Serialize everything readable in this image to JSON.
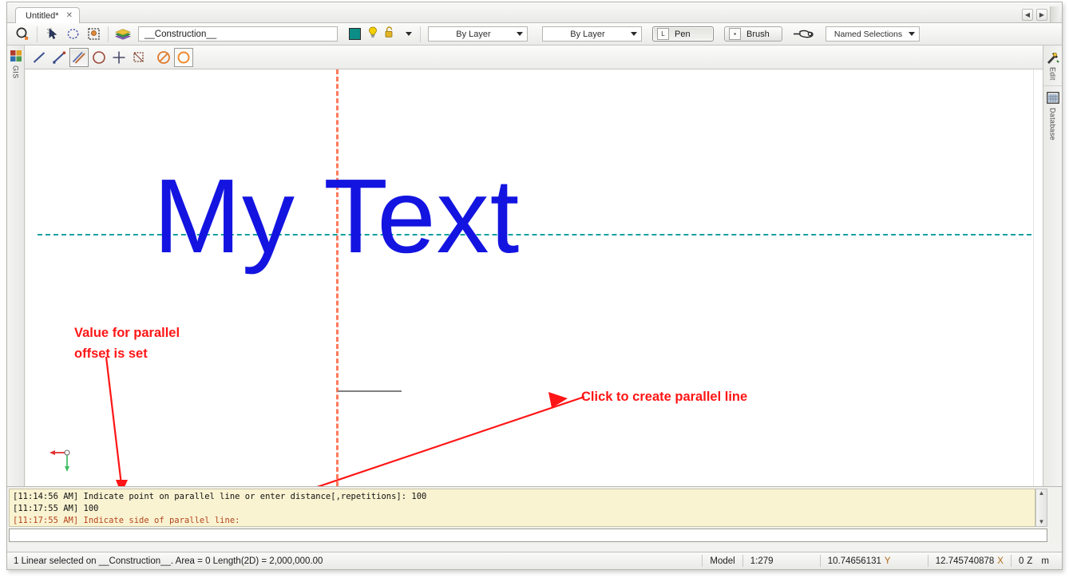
{
  "window": {
    "tab": {
      "title": "Untitled*",
      "close": "✕"
    },
    "tab_nav": {
      "prev": "◀",
      "next": "▶"
    }
  },
  "toolbar": {
    "icons": [
      {
        "name": "select-objects-icon",
        "glyph": "select"
      },
      {
        "name": "pointer-icon",
        "glyph": "pointer"
      },
      {
        "name": "lasso-select-icon",
        "glyph": "lasso"
      },
      {
        "name": "marquee-select-icon",
        "glyph": "marquee"
      },
      {
        "name": "layers-icon",
        "glyph": "layers"
      }
    ],
    "layer_name": "__Construction__",
    "color_swatch": "#0c8d86",
    "lightbulb_icon": "bulb-icon",
    "lock_icon": "lock-icon",
    "layer_dropdown_caret": "▾",
    "linetype_combo": "By Layer",
    "lineweight_combo": "By Layer",
    "pen_button": {
      "label": "Pen",
      "mini": "L"
    },
    "brush_button": {
      "label": "Brush",
      "mini": "▪"
    },
    "snap_icon": "pointing-hand-icon",
    "named_selections": "Named Selections"
  },
  "drawbar": {
    "tools": [
      {
        "name": "line-tool",
        "state": "normal"
      },
      {
        "name": "line-with-endpoint-tool",
        "state": "normal"
      },
      {
        "name": "parallel-line-tool",
        "state": "active"
      },
      {
        "name": "circle-tool",
        "state": "normal"
      },
      {
        "name": "point-tool",
        "state": "normal"
      },
      {
        "name": "region-tool",
        "state": "normal"
      },
      {
        "name": "no-fill-tool",
        "state": "normal"
      },
      {
        "name": "fill-circle-tool",
        "state": "boxed"
      }
    ]
  },
  "left_dock": {
    "gis_label": "GIS",
    "gis_icon": "gis-icon"
  },
  "right_dock": {
    "items": [
      {
        "label": "Edit",
        "icon": "tools-hammer-icon"
      },
      {
        "label": "Database",
        "icon": "grid-table-icon"
      }
    ]
  },
  "canvas": {
    "text_object": "My Text",
    "text_color": "#1414e1",
    "horizontal_guide_color": "#13a0a0",
    "vertical_guide_color": "#ff7a5c",
    "annotations": [
      {
        "name": "annotation-offset-value",
        "line1": "Value for parallel",
        "line2": "offset is set"
      },
      {
        "name": "annotation-click-parallel",
        "line1": "Click to create parallel line",
        "line2": ""
      }
    ],
    "axis_gizmo": {
      "x_color": "#e03131",
      "y_color": "#3fbd62"
    }
  },
  "console": {
    "lines": [
      {
        "text": "[11:14:56 AM] Indicate point on parallel line or enter distance[,repetitions]: 100",
        "style": "normal"
      },
      {
        "text": "[11:17:55 AM] 100",
        "style": "normal"
      },
      {
        "text": "[11:17:55 AM] Indicate side of parallel line:",
        "style": "prompt"
      }
    ],
    "input_value": "",
    "scroll_up": "▲",
    "scroll_down": "▼"
  },
  "statusbar": {
    "selection_info": "1 Linear selected on __Construction__.   Area = 0   Length(2D) = 2,000,000.00",
    "view_mode": "Model",
    "scale": "1:279",
    "coord_y": "10.74656131",
    "coord_y_axis": "Y",
    "coord_x": "12.745740878",
    "coord_x_axis": "X",
    "coord_z": "0",
    "coord_z_axis": "Z",
    "units": "m"
  }
}
